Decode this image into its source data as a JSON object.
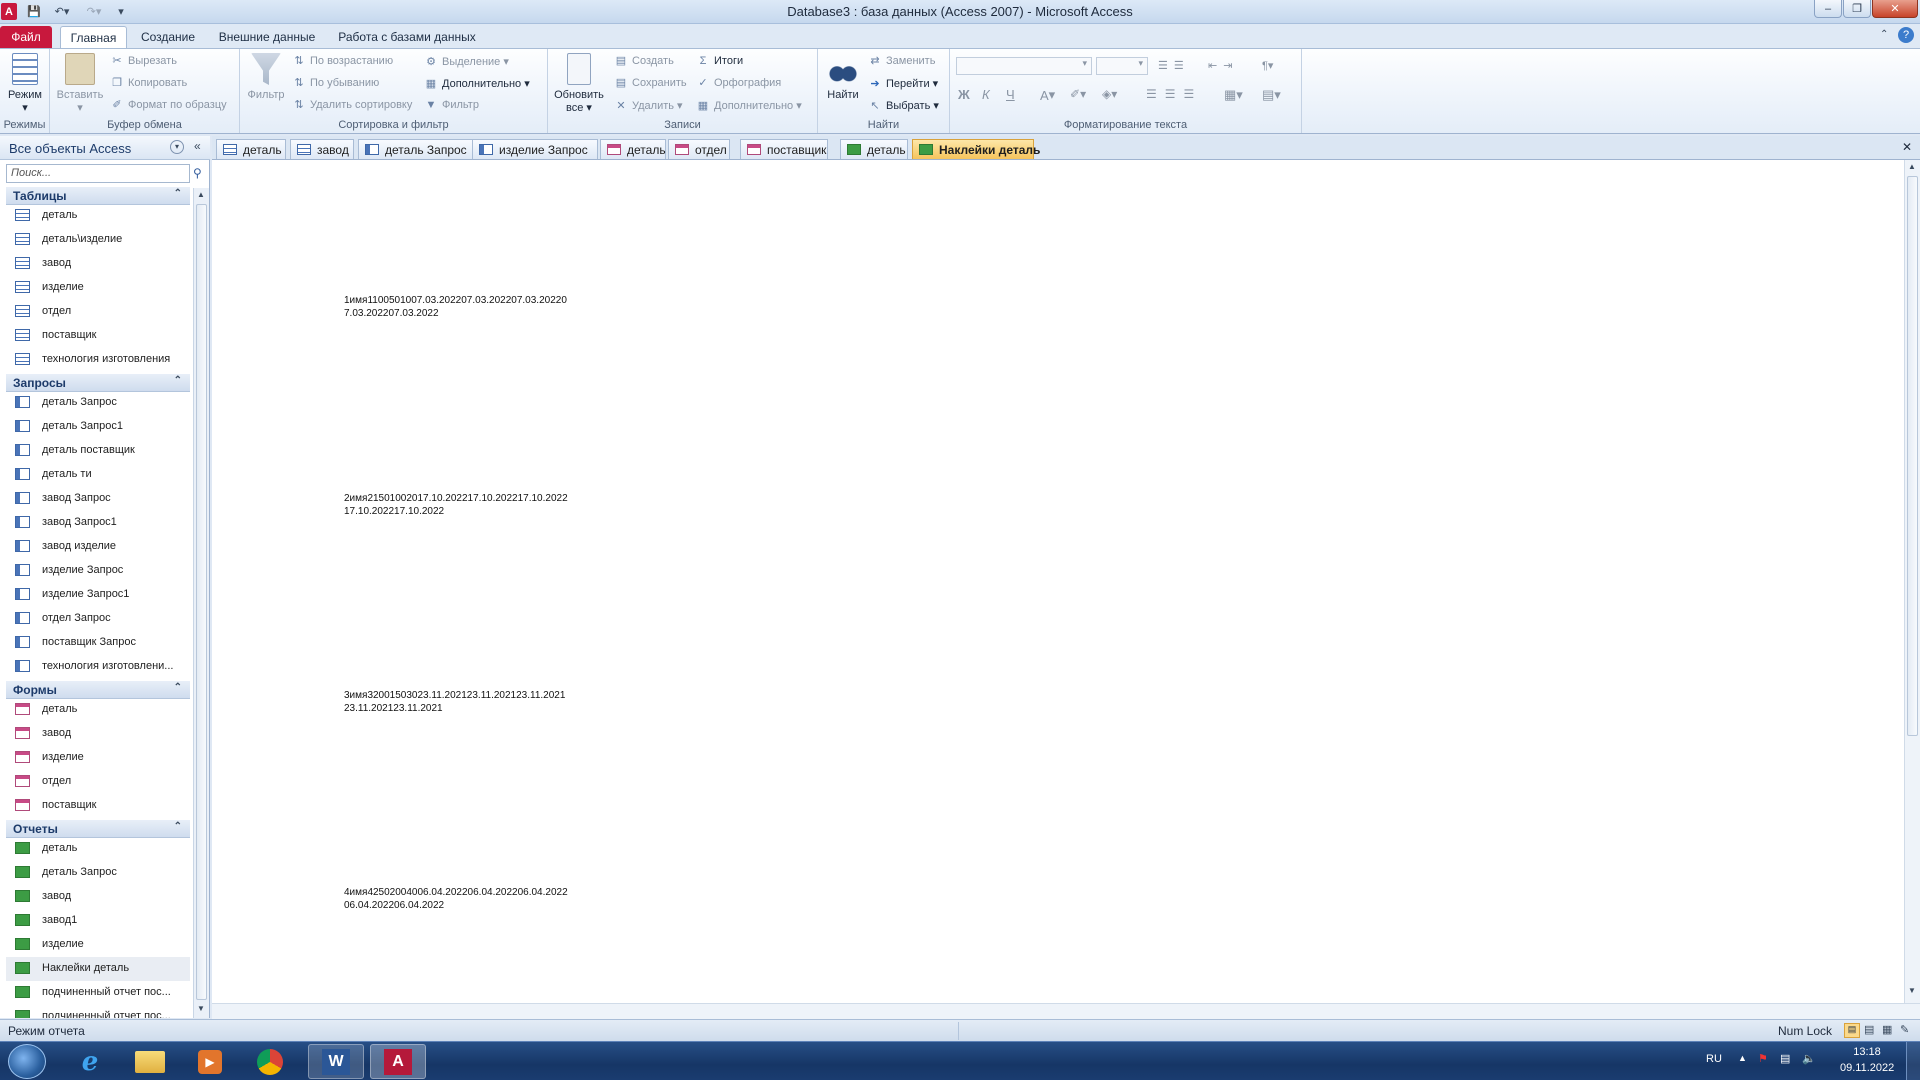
{
  "window": {
    "title": "Database3 : база данных (Access 2007)  -  Microsoft Access",
    "app_icon": "A"
  },
  "ribbon_tabs": [
    "Файл",
    "Главная",
    "Создание",
    "Внешние данные",
    "Работа с базами данных"
  ],
  "ribbon": {
    "views": {
      "label": "Режимы",
      "mode": "Режим"
    },
    "clipboard": {
      "label": "Буфер обмена",
      "paste": "Вставить",
      "cut": "Вырезать",
      "copy": "Копировать",
      "format_painter": "Формат по образцу"
    },
    "sort_filter": {
      "label": "Сортировка и фильтр",
      "filter": "Фильтр",
      "asc": "По возрастанию",
      "desc": "По убыванию",
      "remove_sort": "Удалить сортировку",
      "selection": "Выделение",
      "advanced": "Дополнительно",
      "toggle_filter": "Фильтр"
    },
    "records": {
      "label": "Записи",
      "refresh": "Обновить",
      "refresh2": "все",
      "new": "Создать",
      "save": "Сохранить",
      "delete": "Удалить",
      "totals": "Итоги",
      "spelling": "Орфография",
      "more": "Дополнительно"
    },
    "find": {
      "label": "Найти",
      "find": "Найти",
      "replace": "Заменить",
      "goto": "Перейти",
      "select": "Выбрать"
    },
    "text_format": {
      "label": "Форматирование текста",
      "bold": "Ж",
      "italic": "К",
      "underline": "Ч"
    }
  },
  "nav": {
    "header": "Все объекты Access",
    "search_placeholder": "Поиск...",
    "sections": {
      "tables": {
        "title": "Таблицы",
        "items": [
          "деталь",
          "деталь\\изделие",
          "завод",
          "изделие",
          "отдел",
          "поставщик",
          "технология изготовления"
        ]
      },
      "queries": {
        "title": "Запросы",
        "items": [
          "деталь Запрос",
          "деталь Запрос1",
          "деталь поставщик",
          "деталь ти",
          "завод Запрос",
          "завод Запрос1",
          "завод изделие",
          "изделие Запрос",
          "изделие Запрос1",
          "отдел Запрос",
          "поставщик Запрос",
          "технология изготовлени..."
        ]
      },
      "forms": {
        "title": "Формы",
        "items": [
          "деталь",
          "завод",
          "изделие",
          "отдел",
          "поставщик"
        ]
      },
      "reports": {
        "title": "Отчеты",
        "items": [
          "деталь",
          "деталь Запрос",
          "завод",
          "завод1",
          "изделие",
          "Наклейки деталь",
          "подчиненный отчет пос...",
          "подчиненный отчет пос..."
        ]
      }
    }
  },
  "doc_tabs": [
    {
      "label": "деталь",
      "kind": "table"
    },
    {
      "label": "завод",
      "kind": "table"
    },
    {
      "label": "деталь Запрос",
      "kind": "query"
    },
    {
      "label": "изделие Запрос",
      "kind": "query"
    },
    {
      "label": "деталь",
      "kind": "form"
    },
    {
      "label": "отдел",
      "kind": "form"
    },
    {
      "label": "поставщик",
      "kind": "form"
    },
    {
      "label": "деталь",
      "kind": "report"
    },
    {
      "label": "Наклейки деталь",
      "kind": "report",
      "active": true
    }
  ],
  "report": {
    "labels": [
      {
        "line1": "1имя1100501007.03.202207.03.202207.03.20220",
        "line2": "7.03.202207.03.2022"
      },
      {
        "line1": "2имя21501002017.10.202217.10.202217.10.2022",
        "line2": "17.10.202217.10.2022"
      },
      {
        "line1": "3имя32001503023.11.202123.11.202123.11.2021",
        "line2": "23.11.202123.11.2021"
      },
      {
        "line1": "4имя42502004006.04.202206.04.202206.04.2022",
        "line2": "06.04.202206.04.2022"
      }
    ]
  },
  "status": {
    "left": "Режим отчета",
    "numlock": "Num Lock"
  },
  "taskbar": {
    "lang": "RU",
    "time": "13:18",
    "date": "09.11.2022"
  },
  "colors": {
    "file_tab": "#c8183d",
    "active_doc_tab": "#f6c45c",
    "taskbar": "#163666"
  }
}
